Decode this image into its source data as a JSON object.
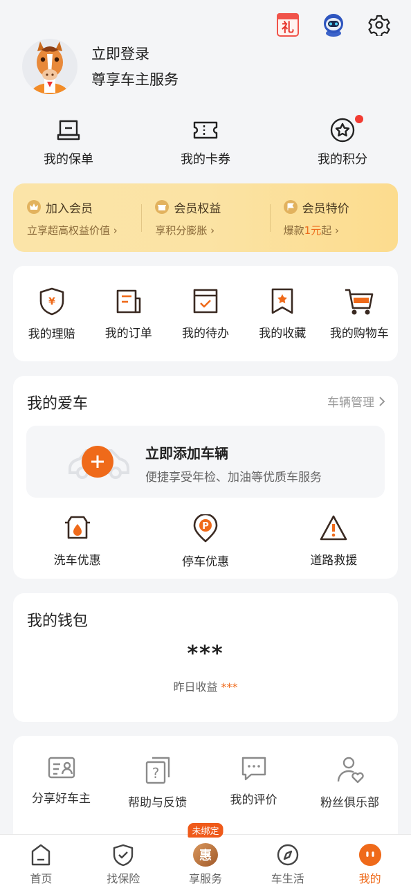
{
  "header": {
    "icons": [
      "gift-calendar-icon",
      "robot-assistant-icon",
      "settings-gear-icon"
    ],
    "gift_char": "礼"
  },
  "profile": {
    "login": "立即登录",
    "subtitle": "尊享车主服务"
  },
  "quick": [
    {
      "label": "我的保单",
      "icon": "policy-icon"
    },
    {
      "label": "我的卡券",
      "icon": "coupon-icon"
    },
    {
      "label": "我的积分",
      "icon": "points-star-icon",
      "has_dot": true
    }
  ],
  "member": [
    {
      "title": "加入会员",
      "desc": "立享超高权益价值",
      "icon": "crown-icon"
    },
    {
      "title": "会员权益",
      "desc": "享积分膨胀",
      "icon": "gift-icon"
    },
    {
      "title": "会员特价",
      "desc_prefix": "爆款",
      "desc_highlight": "1元",
      "desc_suffix": "起",
      "icon": "flag-icon"
    }
  ],
  "grid": [
    {
      "label": "我的理赔",
      "icon": "claim-shield-icon"
    },
    {
      "label": "我的订单",
      "icon": "order-icon"
    },
    {
      "label": "我的待办",
      "icon": "todo-icon"
    },
    {
      "label": "我的收藏",
      "icon": "favorite-icon"
    },
    {
      "label": "我的购物车",
      "icon": "cart-icon"
    }
  ],
  "car": {
    "title": "我的爱车",
    "manage": "车辆管理",
    "add_title": "立即添加车辆",
    "add_desc": "便捷享受年检、加油等优质车服务",
    "services": [
      {
        "label": "洗车优惠",
        "icon": "car-wash-icon"
      },
      {
        "label": "停车优惠",
        "icon": "parking-icon"
      },
      {
        "label": "道路救援",
        "icon": "warning-triangle-icon"
      }
    ]
  },
  "wallet": {
    "title": "我的钱包",
    "amount": "***",
    "yesterday_label": "昨日收益",
    "yesterday_value": "***"
  },
  "tools": [
    {
      "label": "分享好车主",
      "icon": "share-card-icon"
    },
    {
      "label": "帮助与反馈",
      "icon": "help-icon"
    },
    {
      "label": "我的评价",
      "icon": "review-chat-icon"
    },
    {
      "label": "粉丝俱乐部",
      "icon": "fans-club-icon"
    }
  ],
  "tabbar": {
    "badge": "未绑定",
    "tabs": [
      {
        "label": "首页",
        "icon": "home-icon"
      },
      {
        "label": "找保险",
        "icon": "insurance-shield-icon"
      },
      {
        "label": "享服务",
        "icon": "service-hui-icon",
        "char": "惠"
      },
      {
        "label": "车生活",
        "icon": "compass-icon"
      },
      {
        "label": "我的",
        "icon": "me-face-icon",
        "active": true
      }
    ]
  },
  "colors": {
    "accent": "#ef6a1a",
    "red_dot": "#f23b32",
    "member_bg": "#fbe3a4"
  }
}
